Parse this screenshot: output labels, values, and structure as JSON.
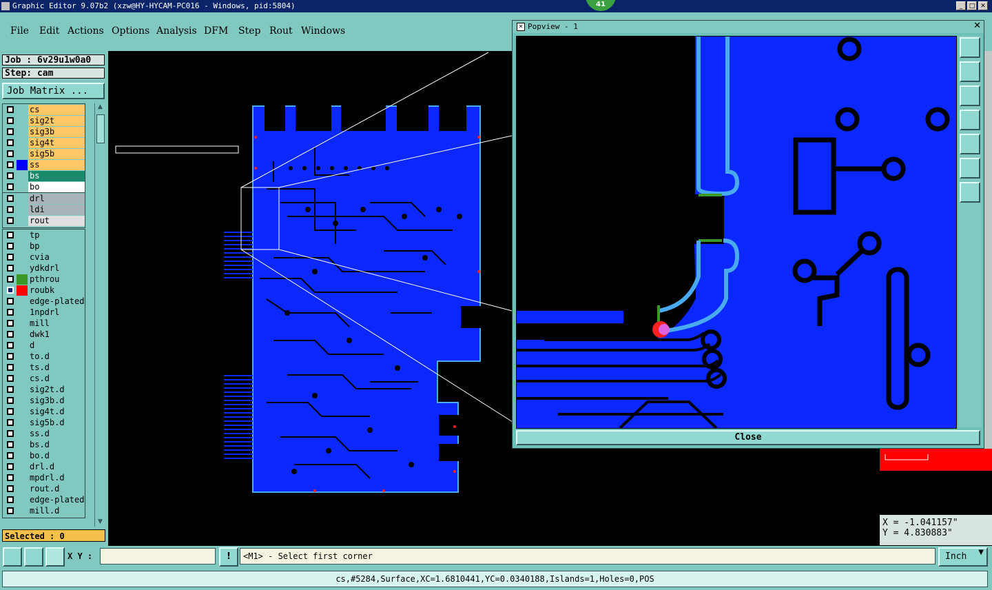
{
  "window": {
    "title": "Graphic Editor 9.07b2 (xzw@HY-HYCAM-PC016 - Windows, pid:5804)",
    "badge": "41"
  },
  "menu": [
    "File",
    "Edit",
    "Actions",
    "Options",
    "Analysis",
    "DFM",
    "Step",
    "Rout",
    "Windows"
  ],
  "job": {
    "label": "Job : 6v29u1w0a0",
    "step": "Step: cam",
    "matrix_button": "Job Matrix ..."
  },
  "layer_groups": [
    [
      {
        "name": "cs",
        "color": "#ffc864"
      },
      {
        "name": "sig2t",
        "color": "#ffc864"
      },
      {
        "name": "sig3b",
        "color": "#ffc864"
      },
      {
        "name": "sig4t",
        "color": "#ffc864"
      },
      {
        "name": "sig5b",
        "color": "#ffc864"
      },
      {
        "name": "ss",
        "color": "#ffc864",
        "swatch": "#0000ff"
      },
      {
        "name": "bs",
        "color": "#1a8a6a"
      },
      {
        "name": "bo",
        "color": "#ffffff"
      }
    ],
    [
      {
        "name": "drl",
        "color": "#a8b4b8"
      },
      {
        "name": "ldi",
        "color": "#a8b4b8"
      },
      {
        "name": "rout",
        "color": "#e0e0e0"
      }
    ],
    [
      {
        "name": "tp",
        "color": "#80c8c0"
      },
      {
        "name": "bp",
        "color": "#80c8c0"
      },
      {
        "name": "cvia",
        "color": "#80c8c0"
      },
      {
        "name": "ydkdrl",
        "color": "#80c8c0"
      },
      {
        "name": "pthrou",
        "color": "#80c8c0",
        "swatch": "#3a9a28"
      },
      {
        "name": "roubk",
        "color": "#80c8c0",
        "swatch": "#ff0000",
        "active": true
      },
      {
        "name": "edge-plated",
        "color": "#80c8c0"
      },
      {
        "name": "1npdrl",
        "color": "#80c8c0"
      },
      {
        "name": "mill",
        "color": "#80c8c0"
      },
      {
        "name": "dwk1",
        "color": "#80c8c0"
      },
      {
        "name": "d",
        "color": "#80c8c0"
      },
      {
        "name": "to.d",
        "color": "#80c8c0"
      },
      {
        "name": "ts.d",
        "color": "#80c8c0"
      },
      {
        "name": "cs.d",
        "color": "#80c8c0"
      },
      {
        "name": "sig2t.d",
        "color": "#80c8c0"
      },
      {
        "name": "sig3b.d",
        "color": "#80c8c0"
      },
      {
        "name": "sig4t.d",
        "color": "#80c8c0"
      },
      {
        "name": "sig5b.d",
        "color": "#80c8c0"
      },
      {
        "name": "ss.d",
        "color": "#80c8c0"
      },
      {
        "name": "bs.d",
        "color": "#80c8c0"
      },
      {
        "name": "bo.d",
        "color": "#80c8c0"
      },
      {
        "name": "drl.d",
        "color": "#80c8c0"
      },
      {
        "name": "mpdrl.d",
        "color": "#80c8c0"
      },
      {
        "name": "rout.d",
        "color": "#80c8c0"
      },
      {
        "name": "edge-plated",
        "color": "#80c8c0"
      },
      {
        "name": "mill.d",
        "color": "#80c8c0"
      }
    ]
  ],
  "selected": "Selected : 0",
  "popview": {
    "title": "Popview - 1",
    "close_label": "Close"
  },
  "coords": {
    "x": "X = -1.041157\"",
    "y": "Y = 4.830883\""
  },
  "bottom": {
    "xy_label": "X Y :",
    "xy_value": "",
    "prompt": "<M1> - Select first corner",
    "units": "Inch"
  },
  "status": "cs,#5284,Surface,XC=1.6810441,YC=0.0340188,Islands=1,Holes=0,POS",
  "colors": {
    "copper": "#0a28ff",
    "trace_highlight": "#4aaaf0",
    "panel": "#80c8c0"
  }
}
